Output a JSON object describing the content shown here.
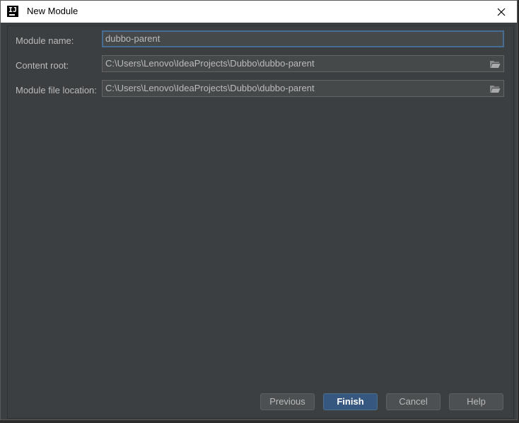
{
  "window": {
    "title": "New Module"
  },
  "form": {
    "module_name": {
      "label": "Module name:",
      "value": "dubbo-parent"
    },
    "content_root": {
      "label": "Content root:",
      "value": "C:\\Users\\Lenovo\\IdeaProjects\\Dubbo\\dubbo-parent"
    },
    "module_file_location": {
      "label": "Module file location:",
      "value": "C:\\Users\\Lenovo\\IdeaProjects\\Dubbo\\dubbo-parent"
    }
  },
  "buttons": {
    "previous": "Previous",
    "finish": "Finish",
    "cancel": "Cancel",
    "help": "Help"
  },
  "icons": {
    "app": "intellij-logo-icon",
    "close": "close-icon",
    "folder": "folder-open-icon"
  },
  "colors": {
    "background": "#3c3f41",
    "field_bg": "#45494a",
    "focus_border": "#466d94",
    "primary_button": "#365880",
    "text": "#bbbbbb"
  }
}
